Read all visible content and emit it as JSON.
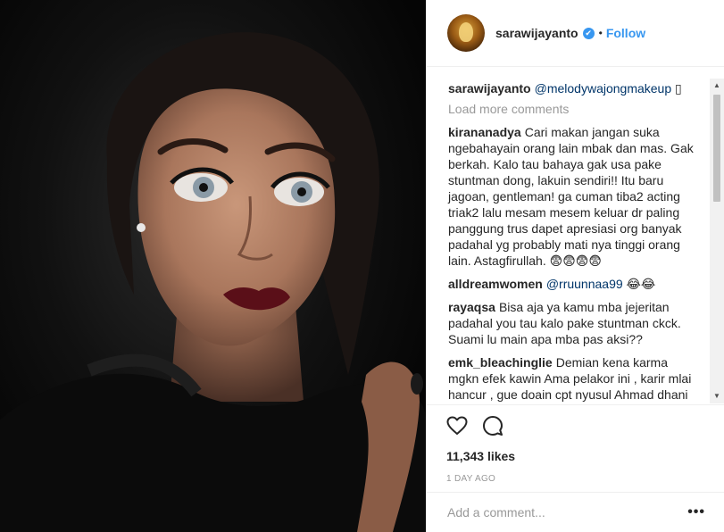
{
  "header": {
    "username": "sarawijayanto",
    "verified_glyph": "✔",
    "separator": "•",
    "follow_label": "Follow"
  },
  "caption": {
    "username": "sarawijayanto",
    "mention": "@melodywajongmakeup",
    "trailing": "▯"
  },
  "load_more_label": "Load more comments",
  "comments": [
    {
      "username": "kirananadya",
      "text": "Cari makan jangan suka ngebahayain orang lain mbak dan mas. Gak berkah. Kalo tau bahaya gak usa pake stuntman dong, lakuin sendiri!! Itu baru jagoan, gentleman! ga cuman tiba2 acting triak2 lalu mesam mesem keluar dr paling panggung trus dapet apresiasi org banyak padahal yg probably mati nya tinggi orang lain. Astagfirullah. 😨😨😨😨"
    },
    {
      "username": "alldreamwomen",
      "mention": "@rruunnaa99",
      "text": "😂😂"
    },
    {
      "username": "rayaqsa",
      "text": "Bisa aja ya kamu mba jejeritan padahal you tau kalo pake stuntman ckck. Suami lu main apa mba pas aksi??"
    },
    {
      "username": "emk_bleachinglie",
      "text": "Demian kena karma mgkn efek kawin Ama pelakor ini , karir mlai hancur , gue doain cpt nyusul Ahmad dhani dnpiere !"
    }
  ],
  "scrollbar": {
    "up": "▲",
    "down": "▼"
  },
  "likes": "11,343 likes",
  "timestamp": "1 DAY AGO",
  "add_comment": {
    "placeholder": "Add a comment..."
  },
  "more_label": "•••",
  "icons": {
    "like": "heart-icon",
    "comment": "comment-bubble-icon",
    "avatar": "profile-photo"
  },
  "colors": {
    "accent": "#3897f0",
    "text": "#262626",
    "muted": "#999999",
    "border": "#efefef",
    "lip": "#5a0f18"
  }
}
